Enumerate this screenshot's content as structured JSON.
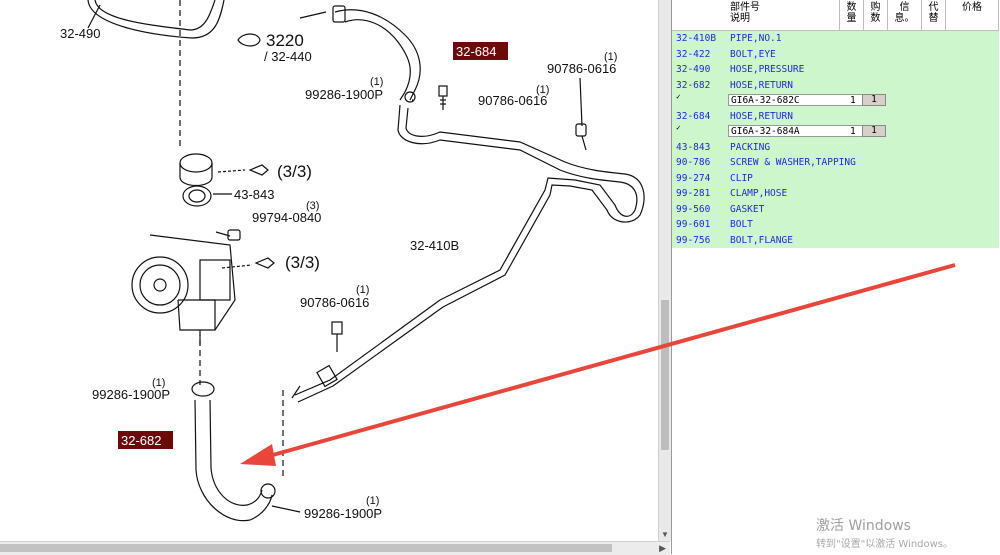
{
  "diagram": {
    "labels": {
      "l_32_490": "32-490",
      "l_3220": "3220",
      "l_32_440": "/ 32-440",
      "l_32_684": "32-684",
      "l_99286_top": "99286-1900P",
      "l_1_a": "(1)",
      "l_90786_a": "90786-0616",
      "l_1_b": "(1)",
      "l_90786_b": "90786-0616",
      "l_1_c": "(1)",
      "l_33_a": "(3/3)",
      "l_43_843": "43-843",
      "l_3_a": "(3)",
      "l_99794": "99794-0840",
      "l_33_b": "(3/3)",
      "l_32_410b": "32-410B",
      "l_1_d": "(1)",
      "l_90786_c": "90786-0616",
      "l_1_e": "(1)",
      "l_99286_mid": "99286-1900P",
      "l_32_682": "32-682",
      "l_1_f": "(1)",
      "l_99286_bot": "99286-1900P"
    }
  },
  "panel": {
    "headers": {
      "partno": "部件号",
      "desc": "说明",
      "qty": "数量",
      "buy": "购数",
      "info": "信息。",
      "sub": "代替",
      "price": "价格"
    },
    "rows": [
      {
        "code": "32-410B",
        "desc": "PIPE,NO.1"
      },
      {
        "code": "32-422",
        "desc": "BOLT,EYE"
      },
      {
        "code": "32-490",
        "desc": "HOSE,PRESSURE"
      },
      {
        "code": "32-682",
        "desc": "HOSE,RETURN"
      },
      {
        "part": "GI6A-32-682C",
        "qty": "1",
        "order": "1"
      },
      {
        "code": "32-684",
        "desc": "HOSE,RETURN"
      },
      {
        "part": "GI6A-32-684A",
        "qty": "1",
        "order": "1"
      },
      {
        "code": "43-843",
        "desc": "PACKING"
      },
      {
        "code": "90-786",
        "desc": "SCREW & WASHER,TAPPING"
      },
      {
        "code": "99-274",
        "desc": "CLIP"
      },
      {
        "code": "99-281",
        "desc": "CLAMP,HOSE"
      },
      {
        "code": "99-560",
        "desc": "GASKET"
      },
      {
        "code": "99-601",
        "desc": "BOLT"
      },
      {
        "code": "99-756",
        "desc": "BOLT,FLANGE"
      }
    ],
    "check_mark": "✓"
  },
  "watermark": {
    "line1": "激活 Windows",
    "line2": "转到\"设置\"以激活 Windows。"
  },
  "colors": {
    "row_bg": "#cdf6cd",
    "row_text": "#1d2bd0",
    "highlight_label": "#6b0a0a",
    "arrow": "#e8463a"
  }
}
